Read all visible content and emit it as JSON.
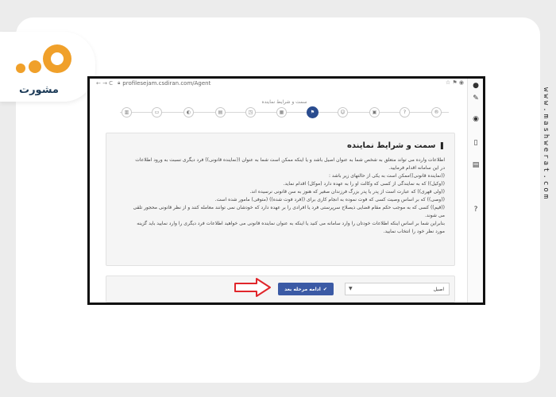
{
  "brand": {
    "logo_text": "مشورت",
    "side_url": "www.mashwerat.com"
  },
  "browser": {
    "url": "profilesejam.csdiran.com/Agent",
    "nav": "← →  C"
  },
  "stepper": {
    "caption": "سمت و شرایط نماینده",
    "steps": [
      "®",
      "?",
      "▣",
      "☺",
      "⚑",
      "▦",
      "◳",
      "▤",
      "◐",
      "▭",
      "▥"
    ]
  },
  "info": {
    "title": "سمت و شرایط نماینده",
    "lines": [
      "اطلاعات وارده می تواند متعلق به شخص شما به عنوان اصیل باشد و یا اینکه ممکن است شما به عنوان ((نماینده قانونی)) فرد دیگری نسبت به ورود اطلاعات",
      "در این سامانه اقدام فرمایید.",
      "((نماینده قانونی))ممکن است به یکی از حالتهای زیر باشد :",
      "((وکیل)) که به نمایندگی از کسی که وکالت او را به عهده دارد (موکل) اقدام نماید.",
      "((ولی قهری)) که عبارت است از پدر یا پدر بزرگ فرزندان صغیر که هنوز به سن قانونی نرسیده اند.",
      "((وصی)) که بر اساس وصیت کسی که فوت نموده به انجام کاری برای ((فرد فوت شده)) (متوفی) مامور شده است.",
      "((قیم)) کسی که به موجب حکم مقام قضایی ذیصلاح سرپرستی فرد یا افرادی را بر عهده دارد که خودشان نمی توانند معامله کنند و از نظر قانونی محجور تلقی",
      "می شوند.",
      "بنابراین شما بر اساس اینکه اطلاعات خودتان را وارد سامانه می کنید یا اینکه به عنوان نماینده قانونی می خواهید اطلاعات فرد دیگری را وارد نمایید باید گزینه",
      "مورد نظر خود را انتخاب نمایید."
    ]
  },
  "actions": {
    "select_value": "اصیل",
    "next_label": "ادامه مرحله بعد"
  },
  "toolbar": {
    "icons": [
      "✎",
      "◉",
      "▯",
      "▤",
      "?"
    ]
  }
}
